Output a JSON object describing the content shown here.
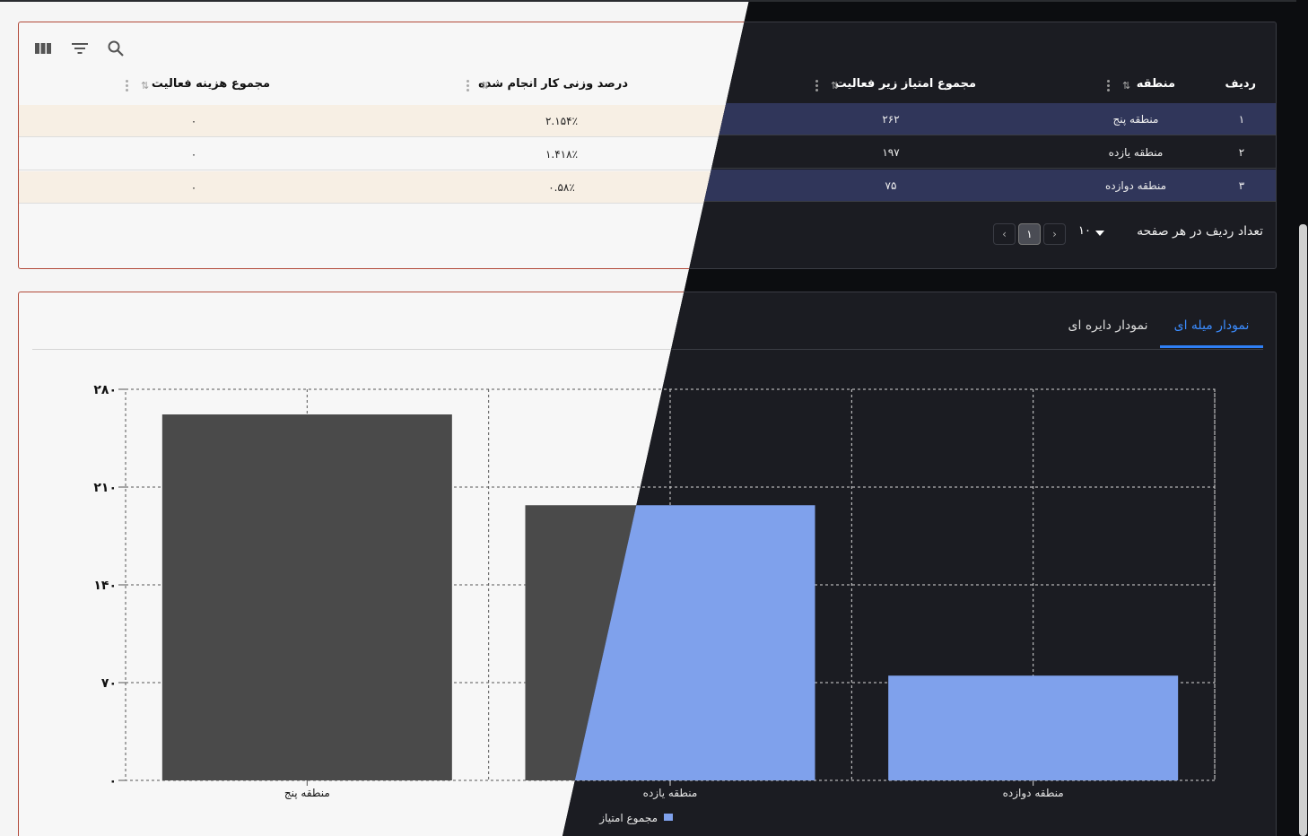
{
  "toolbar": {
    "icons": [
      "columns-icon",
      "filter-icon",
      "search-icon"
    ]
  },
  "table": {
    "columns": [
      {
        "key": "row",
        "label": "ردیف"
      },
      {
        "key": "region",
        "label": "منطقه"
      },
      {
        "key": "score",
        "label": "مجموع امتیاز زیر فعالیت"
      },
      {
        "key": "weighted",
        "label": "درصد وزنی کار انجام شده"
      },
      {
        "key": "cost",
        "label": "مجموع هزینه فعالیت"
      }
    ],
    "rows": [
      {
        "row": "۱",
        "region": "منطقه پنج",
        "score": "۲۶۲",
        "weighted": "۲.۱۵۴٪",
        "cost": "۰"
      },
      {
        "row": "۲",
        "region": "منطقه یازده",
        "score": "۱۹۷",
        "weighted": "۱.۴۱۸٪",
        "cost": "۰"
      },
      {
        "row": "۳",
        "region": "منطقه دوازده",
        "score": "۷۵",
        "weighted": "۰.۵۸٪",
        "cost": "۰"
      }
    ]
  },
  "pagination": {
    "rows_per_page_label": "تعداد ردیف در هر صفحه",
    "rows_per_page_value": "۱۰",
    "current_page": "۱",
    "prev_symbol": "‹",
    "next_symbol": "›"
  },
  "tabs": [
    {
      "label": "نمودار میله ای",
      "active": true
    },
    {
      "label": "نمودار دایره ای",
      "active": false
    }
  ],
  "colors": {
    "bar_dark_theme": "#7fa1ec",
    "bar_light_theme": "#4a4a4a",
    "accent": "#2f7ff6"
  },
  "chart_data": {
    "type": "bar",
    "categories": [
      "منطقه پنج",
      "منطقه یازده",
      "منطقه دوازده"
    ],
    "series": [
      {
        "name": "مجموع امتیاز",
        "values": [
          262,
          197,
          75
        ]
      }
    ],
    "ylim": [
      0,
      280
    ],
    "yticks": [
      "۰",
      "۷۰",
      "۱۴۰",
      "۲۱۰",
      "۲۸۰"
    ],
    "ytick_values": [
      0,
      70,
      140,
      210,
      280
    ],
    "grid": true,
    "legend": "bottom"
  }
}
